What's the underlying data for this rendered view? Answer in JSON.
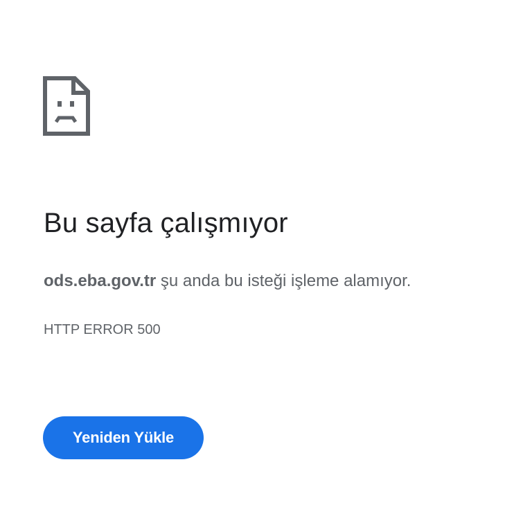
{
  "icon": {
    "name": "sad-page-icon",
    "color": "#5f6368"
  },
  "headline": "Bu sayfa çalışmıyor",
  "message": {
    "host": "ods.eba.gov.tr",
    "text": " şu anda bu isteği işleme alamıyor."
  },
  "error_code": "HTTP ERROR 500",
  "reload_button": {
    "label": "Yeniden Yükle",
    "color": "#1a73e8"
  }
}
